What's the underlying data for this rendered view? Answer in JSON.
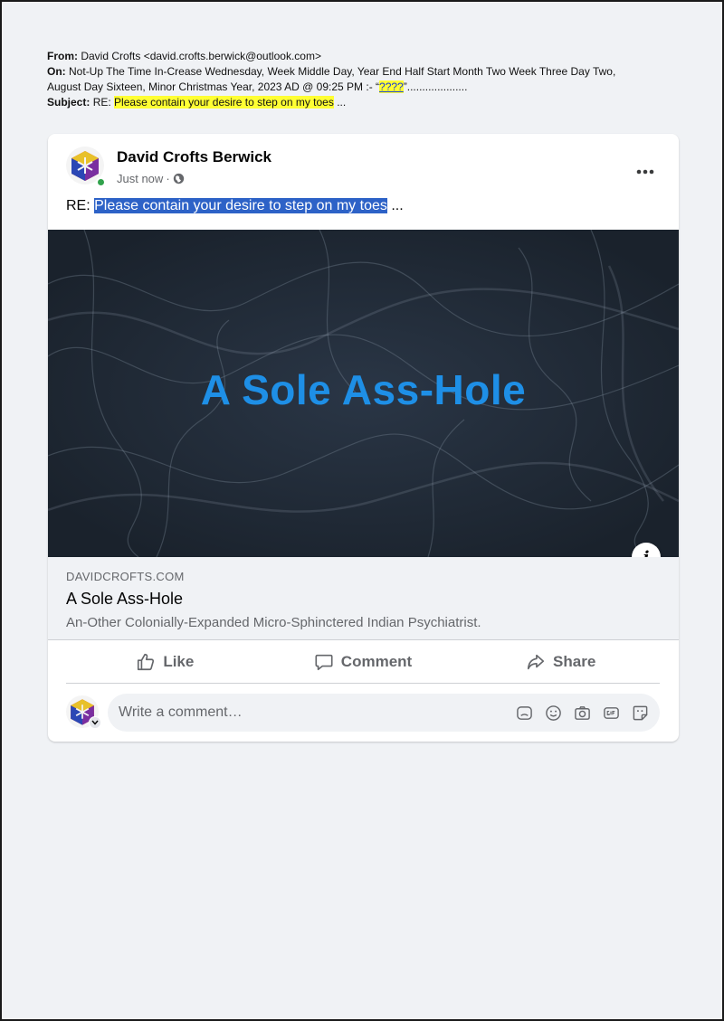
{
  "email": {
    "from_label": "From:",
    "from_value": "David Crofts <david.crofts.berwick@outlook.com>",
    "on_label": "On:",
    "on_value": "Not-Up The Time In-Crease Wednesday, Week Middle Day, Year End Half Start Month Two Week Three Day Two, August Day Sixteen, Minor Christmas Year, 2023 AD @ 09:25 PM :- “",
    "on_question": "????",
    "on_suffix": "”....................",
    "subject_label": "Subject:",
    "subject_prefix": "RE:",
    "subject_highlight": "Please contain your desire to step on my toes",
    "subject_suffix": "..."
  },
  "post": {
    "author": "David Crofts Berwick",
    "time": "Just now",
    "time_separator": "·",
    "text_prefix": "RE:",
    "text_selected": "Please contain your desire to step on my toes",
    "text_suffix": "...",
    "image_title": "A Sole Ass-Hole",
    "info_glyph": "i",
    "link_domain": "DAVIDCROFTS.COM",
    "link_title": "A Sole Ass-Hole",
    "link_desc": "An-Other Colonially-Expanded Micro-Sphinctered Indian Psychiatrist.",
    "actions": {
      "like": "Like",
      "comment": "Comment",
      "share": "Share"
    },
    "comment_placeholder": "Write a comment…"
  },
  "colors": {
    "page_bg": "#f0f2f5",
    "card_bg": "#ffffff",
    "highlight": "#ffff33",
    "selection": "#2d62c7",
    "image_bg": "#222c38",
    "image_title": "#1e8fe6",
    "muted_text": "#65676b",
    "online": "#31a24c"
  },
  "icons": [
    "profile-cube-icon",
    "globe-icon",
    "more-icon",
    "info-icon",
    "like-icon",
    "comment-icon",
    "share-icon",
    "avatar-icon",
    "sticker-icon",
    "emoji-icon",
    "camera-icon",
    "gif-icon",
    "sticker-face-icon"
  ]
}
